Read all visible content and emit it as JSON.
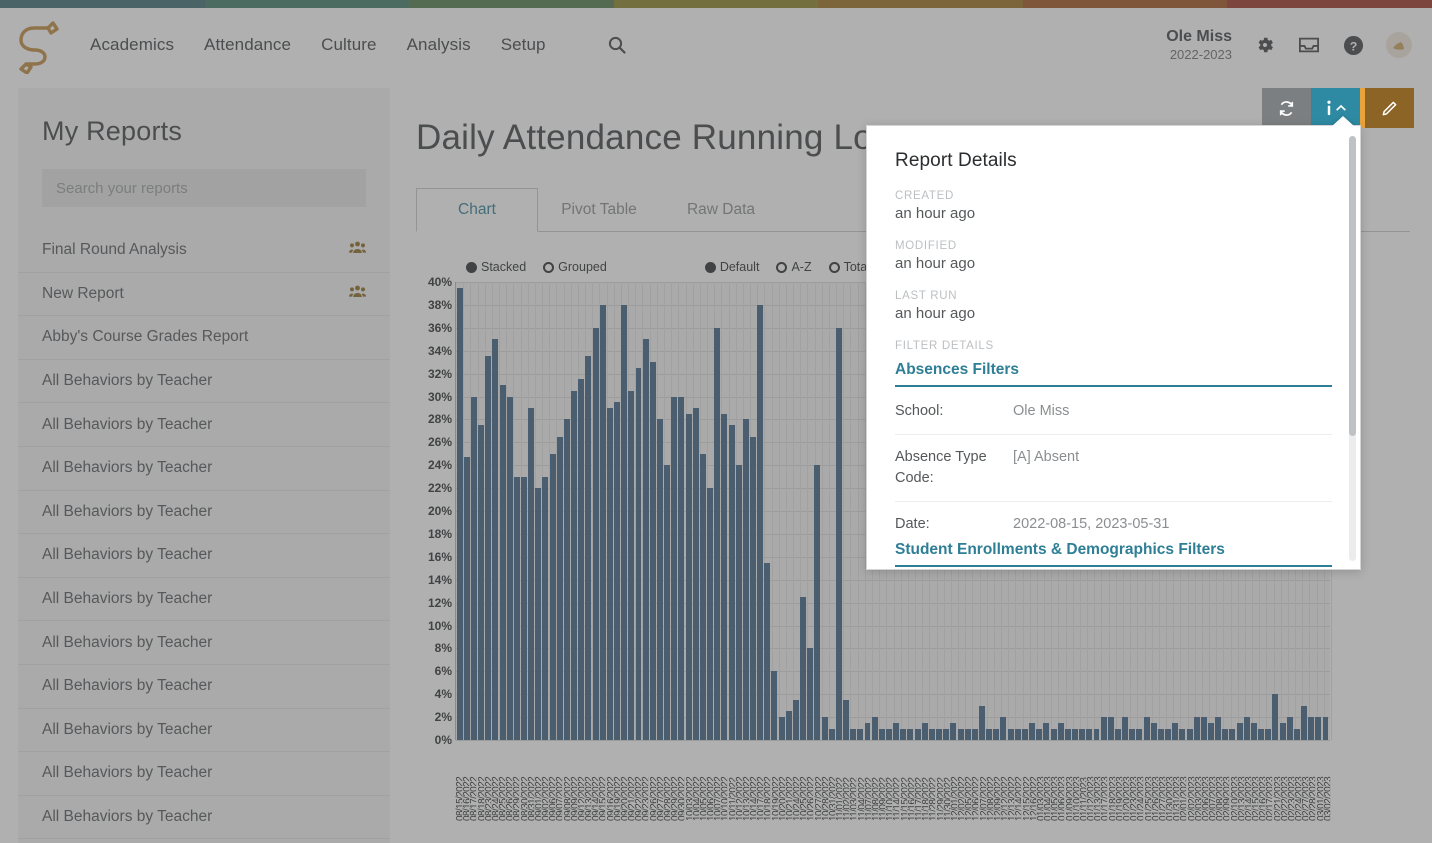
{
  "topbar_colors": [
    "#3c6b72",
    "#3f7a66",
    "#4f7a4a",
    "#8a8227",
    "#9c6f1e",
    "#a3541f",
    "#9c3526"
  ],
  "brand": {
    "accent_teal": "#2e8aa3",
    "accent_orange": "#e8a33d",
    "accent_brown": "#8c6426",
    "bar_blue": "#3f6284",
    "logo_gold": "#c08a3e"
  },
  "header": {
    "logo_name": "school-logo",
    "nav": [
      {
        "label": "Academics",
        "name": "nav-academics"
      },
      {
        "label": "Attendance",
        "name": "nav-attendance"
      },
      {
        "label": "Culture",
        "name": "nav-culture"
      },
      {
        "label": "Analysis",
        "name": "nav-analysis"
      },
      {
        "label": "Setup",
        "name": "nav-setup"
      }
    ],
    "search_icon": "search-icon",
    "school_name": "Ole Miss",
    "school_year": "2022-2023",
    "icons": [
      "gear-icon",
      "inbox-icon",
      "help-icon",
      "avatar"
    ]
  },
  "sidebar": {
    "title": "My Reports",
    "search_placeholder": "Search your reports",
    "search_value": "",
    "items": [
      {
        "label": "Final Round Analysis",
        "shared": true
      },
      {
        "label": "New Report",
        "shared": true
      },
      {
        "label": "Abby's Course Grades Report",
        "shared": false
      },
      {
        "label": "All Behaviors by Teacher",
        "shared": false
      },
      {
        "label": "All Behaviors by Teacher",
        "shared": false
      },
      {
        "label": "All Behaviors by Teacher",
        "shared": false
      },
      {
        "label": "All Behaviors by Teacher",
        "shared": false
      },
      {
        "label": "All Behaviors by Teacher",
        "shared": false
      },
      {
        "label": "All Behaviors by Teacher",
        "shared": false
      },
      {
        "label": "All Behaviors by Teacher",
        "shared": false
      },
      {
        "label": "All Behaviors by Teacher",
        "shared": false
      },
      {
        "label": "All Behaviors by Teacher",
        "shared": false
      },
      {
        "label": "All Behaviors by Teacher",
        "shared": false
      },
      {
        "label": "All Behaviors by Teacher",
        "shared": false
      }
    ]
  },
  "main": {
    "page_title": "Daily Attendance Running Log",
    "tabs": [
      {
        "label": "Chart",
        "active": true
      },
      {
        "label": "Pivot Table",
        "active": false
      },
      {
        "label": "Raw Data",
        "active": false
      }
    ]
  },
  "toolbar": {
    "refresh_icon": "refresh-icon",
    "info_icon": "info-icon",
    "info_chevron": "chevron-up-icon",
    "edit_icon": "pencil-icon"
  },
  "popover": {
    "title": "Report Details",
    "meta": [
      {
        "label": "CREATED",
        "value": "an hour ago"
      },
      {
        "label": "MODIFIED",
        "value": "an hour ago"
      },
      {
        "label": "LAST RUN",
        "value": "an hour ago"
      }
    ],
    "filter_details_label": "FILTER DETAILS",
    "sections": [
      {
        "heading": "Absences Filters",
        "rows": [
          {
            "key": "School:",
            "value": "Ole Miss"
          },
          {
            "key": "Absence Type Code:",
            "value": "[A] Absent"
          },
          {
            "key": "Date:",
            "value": "2022-08-15, 2023-05-31"
          }
        ]
      },
      {
        "heading": "Student Enrollments & Demographics Filters",
        "rows": []
      }
    ]
  },
  "chart_data": {
    "type": "bar",
    "title": "",
    "xlabel": "",
    "ylabel": "",
    "ylim": [
      0,
      40
    ],
    "ytick_step": 2,
    "ytick_labels": [
      "0%",
      "2%",
      "4%",
      "6%",
      "8%",
      "10%",
      "12%",
      "14%",
      "16%",
      "18%",
      "20%",
      "22%",
      "24%",
      "26%",
      "28%",
      "30%",
      "32%",
      "34%",
      "36%",
      "38%",
      "40%"
    ],
    "grid": true,
    "legend_position": "top",
    "controls": {
      "layout": {
        "options": [
          "Stacked",
          "Grouped"
        ],
        "selected": "Stacked"
      },
      "sort": {
        "options": [
          "Default",
          "A-Z",
          "Total"
        ],
        "selected": "Default"
      }
    },
    "categories": [
      "08/15/2022",
      "08/16/2022",
      "08/17/2022",
      "08/18/2022",
      "08/23/2022",
      "08/24/2022",
      "08/25/2022",
      "08/26/2022",
      "08/29/2022",
      "08/30/2022",
      "08/31/2022",
      "09/01/2022",
      "09/02/2022",
      "09/06/2022",
      "09/07/2022",
      "09/08/2022",
      "09/09/2022",
      "09/12/2022",
      "09/13/2022",
      "09/14/2022",
      "09/15/2022",
      "09/16/2022",
      "09/19/2022",
      "09/20/2022",
      "09/21/2022",
      "09/22/2022",
      "09/23/2022",
      "09/26/2022",
      "09/27/2022",
      "09/28/2022",
      "09/29/2022",
      "09/30/2022",
      "10/03/2022",
      "10/04/2022",
      "10/05/2022",
      "10/06/2022",
      "10/07/2022",
      "10/10/2022",
      "10/11/2022",
      "10/12/2022",
      "10/13/2022",
      "10/14/2022",
      "10/17/2022",
      "10/18/2022",
      "10/19/2022",
      "10/20/2022",
      "10/21/2022",
      "10/24/2022",
      "10/25/2022",
      "10/26/2022",
      "10/27/2022",
      "10/28/2022",
      "10/31/2022",
      "11/01/2022",
      "11/02/2022",
      "11/03/2022",
      "11/04/2022",
      "11/07/2022",
      "11/08/2022",
      "11/09/2022",
      "11/10/2022",
      "11/14/2022",
      "11/15/2022",
      "11/16/2022",
      "11/17/2022",
      "11/18/2022",
      "11/28/2022",
      "11/29/2022",
      "11/30/2022",
      "12/01/2022",
      "12/02/2022",
      "12/05/2022",
      "12/06/2022",
      "12/07/2022",
      "12/08/2022",
      "12/09/2022",
      "12/12/2022",
      "12/13/2022",
      "12/14/2022",
      "12/15/2022",
      "12/16/2022",
      "01/03/2023",
      "01/04/2023",
      "01/05/2023",
      "01/06/2023",
      "01/09/2023",
      "01/10/2023",
      "01/11/2023",
      "01/12/2023",
      "01/13/2023",
      "01/17/2023",
      "01/18/2023",
      "01/19/2023",
      "01/20/2023",
      "01/23/2023",
      "01/24/2023",
      "01/25/2023",
      "01/26/2023",
      "01/27/2023",
      "01/30/2023",
      "01/31/2023",
      "02/01/2023",
      "02/02/2023",
      "02/03/2023",
      "02/06/2023",
      "02/07/2023",
      "02/08/2023",
      "02/09/2023",
      "02/10/2023",
      "02/13/2023",
      "02/14/2023",
      "02/15/2023",
      "02/16/2023",
      "02/17/2023",
      "02/21/2023",
      "02/22/2023",
      "02/23/2023",
      "02/24/2023",
      "02/27/2023",
      "02/28/2023",
      "03/01/2023",
      "03/02/2023"
    ],
    "series": [
      {
        "name": "[A] Absent",
        "color": "#3f6284",
        "values": [
          39.5,
          24.7,
          30.0,
          27.5,
          33.5,
          35.0,
          31.0,
          30.0,
          23.0,
          23.0,
          29.0,
          22.0,
          23.0,
          25.0,
          26.5,
          28.0,
          30.5,
          31.5,
          33.5,
          36.0,
          38.0,
          29.0,
          29.5,
          38.0,
          30.5,
          32.5,
          35.0,
          33.0,
          28.0,
          24.0,
          30.0,
          30.0,
          28.5,
          29.0,
          25.0,
          22.0,
          36.0,
          28.5,
          27.5,
          24.0,
          28.0,
          26.5,
          38.0,
          15.5,
          6.0,
          2.0,
          2.5,
          3.5,
          12.5,
          8.0,
          24.0,
          2.0,
          1.0,
          36.0,
          3.5,
          1.0,
          1.0,
          1.5,
          2.0,
          1.0,
          1.0,
          1.5,
          1.0,
          1.0,
          1.0,
          1.5,
          1.0,
          1.0,
          1.0,
          1.5,
          1.0,
          1.0,
          1.0,
          3.0,
          1.0,
          1.0,
          2.0,
          1.0,
          1.0,
          1.0,
          1.5,
          1.0,
          1.5,
          1.0,
          1.5,
          1.0,
          1.0,
          1.0,
          1.0,
          1.0,
          2.0,
          2.0,
          1.0,
          2.0,
          1.0,
          1.0,
          2.0,
          1.5,
          1.0,
          1.0,
          1.5,
          1.0,
          1.0,
          2.0,
          2.0,
          1.5,
          2.0,
          1.0,
          1.0,
          1.5,
          2.0,
          1.5,
          1.0,
          1.0,
          4.0,
          1.5,
          2.0,
          1.0,
          3.0,
          2.0,
          2.0,
          2.0
        ]
      }
    ]
  }
}
